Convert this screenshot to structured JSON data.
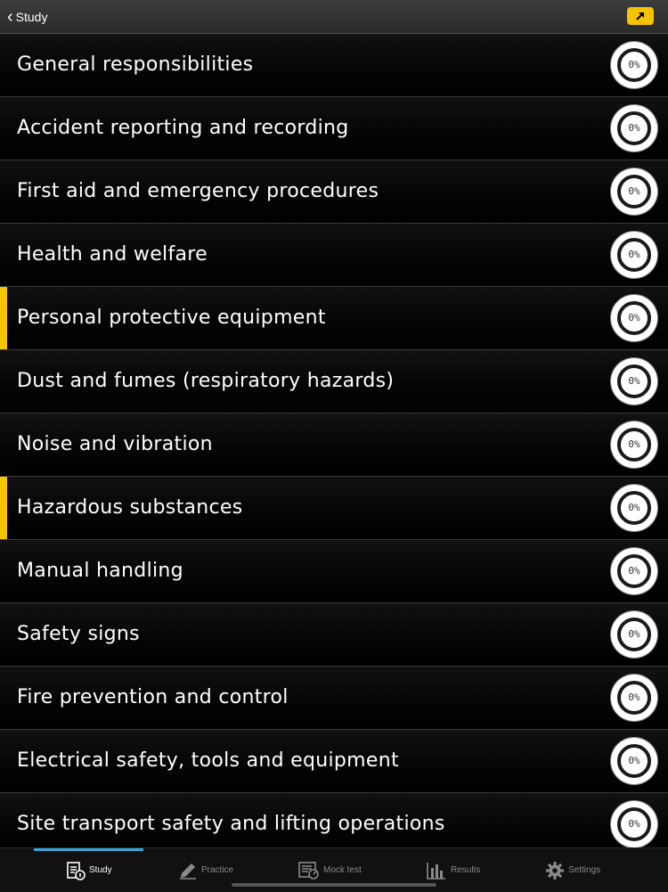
{
  "header": {
    "back_label": "Study",
    "accent_color": "#f5c400"
  },
  "topics": [
    {
      "label": "General responsibilities",
      "progress": "0%",
      "highlighted": false
    },
    {
      "label": "Accident reporting and recording",
      "progress": "0%",
      "highlighted": false
    },
    {
      "label": "First aid and emergency procedures",
      "progress": "0%",
      "highlighted": false
    },
    {
      "label": "Health and welfare",
      "progress": "0%",
      "highlighted": false
    },
    {
      "label": "Personal protective equipment",
      "progress": "0%",
      "highlighted": true
    },
    {
      "label": "Dust and fumes (respiratory hazards)",
      "progress": "0%",
      "highlighted": false
    },
    {
      "label": "Noise and vibration",
      "progress": "0%",
      "highlighted": false
    },
    {
      "label": "Hazardous substances",
      "progress": "0%",
      "highlighted": true
    },
    {
      "label": "Manual handling",
      "progress": "0%",
      "highlighted": false
    },
    {
      "label": "Safety signs",
      "progress": "0%",
      "highlighted": false
    },
    {
      "label": "Fire prevention and control",
      "progress": "0%",
      "highlighted": false
    },
    {
      "label": "Electrical safety, tools and equipment",
      "progress": "0%",
      "highlighted": false
    },
    {
      "label": "Site transport safety and lifting operations",
      "progress": "0%",
      "highlighted": false
    }
  ],
  "tabs": [
    {
      "label": "Study",
      "icon": "study-icon",
      "active": true
    },
    {
      "label": "Practice",
      "icon": "pencil-icon",
      "active": false
    },
    {
      "label": "Mock test",
      "icon": "mock-test-icon",
      "active": false
    },
    {
      "label": "Results",
      "icon": "bar-chart-icon",
      "active": false
    },
    {
      "label": "Settings",
      "icon": "gear-icon",
      "active": false
    }
  ],
  "tab_indicator_color": "#39a5d8"
}
